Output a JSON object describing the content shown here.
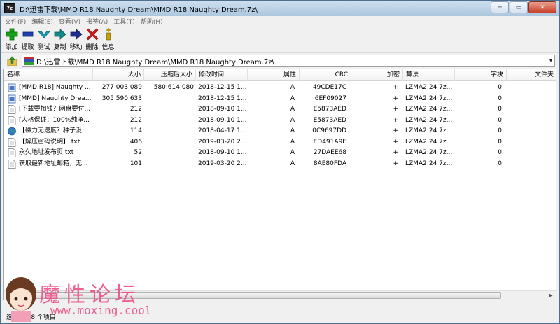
{
  "window": {
    "app_icon_text": "7z",
    "title": "D:\\迅雷下载\\MMD R18 Naughty Dream\\MMD R18 Naughty Dream.7z\\",
    "btn_min": "─",
    "btn_max": "▭",
    "btn_close": "✕"
  },
  "menu": {
    "items": [
      "文件(F)",
      "编辑(E)",
      "查看(V)",
      "书签(A)",
      "工具(T)",
      "帮助(H)"
    ]
  },
  "toolbar": {
    "add": "添加",
    "extract": "提取",
    "test": "测试",
    "copy": "复制",
    "move": "移动",
    "delete": "删除",
    "info": "信息"
  },
  "address": {
    "path": "D:\\迅雷下载\\MMD R18 Naughty Dream\\MMD R18 Naughty Dream.7z\\",
    "dropdown": "▾"
  },
  "columns": {
    "name": "名称",
    "size": "大小",
    "packed": "压缩后大小",
    "modified": "修改时间",
    "attr": "属性",
    "crc": "CRC",
    "encrypted": "加密",
    "method": "算法",
    "block": "字块",
    "folders": "文件夹"
  },
  "rows": [
    {
      "icon": "video-file-icon",
      "name": "[MMD R18] Naughty ...",
      "size": "277 003 089",
      "packed": "580 614 080",
      "modified": "2018-12-15 1...",
      "attr": "A",
      "crc": "49CDE17C",
      "encrypted": "+",
      "method": "LZMA2:24 7z...",
      "block": "0"
    },
    {
      "icon": "video-file-icon",
      "name": "[MMD] Naughty Drea...",
      "size": "305 590 633",
      "packed": "",
      "modified": "2018-12-15 1...",
      "attr": "A",
      "crc": "6EF09027",
      "encrypted": "+",
      "method": "LZMA2:24 7z...",
      "block": "0"
    },
    {
      "icon": "text-file-icon",
      "name": "[下载要掏钱？网盘要付...",
      "size": "212",
      "packed": "",
      "modified": "2018-09-10 1...",
      "attr": "A",
      "crc": "E5873AED",
      "encrypted": "+",
      "method": "LZMA2:24 7z...",
      "block": "0"
    },
    {
      "icon": "text-file-icon",
      "name": "[人格保证：100%纯净...",
      "size": "212",
      "packed": "",
      "modified": "2018-09-10 1...",
      "attr": "A",
      "crc": "E5873AED",
      "encrypted": "+",
      "method": "LZMA2:24 7z...",
      "block": "0"
    },
    {
      "icon": "globe-file-icon",
      "name": "【磁力无速度？种子没...",
      "size": "114",
      "packed": "",
      "modified": "2018-04-17 1...",
      "attr": "A",
      "crc": "0C9697DD",
      "encrypted": "+",
      "method": "LZMA2:24 7z...",
      "block": "0"
    },
    {
      "icon": "text-file-icon",
      "name": "【解压密码说明】.txt",
      "size": "406",
      "packed": "",
      "modified": "2019-03-20 2...",
      "attr": "A",
      "crc": "ED491A9E",
      "encrypted": "+",
      "method": "LZMA2:24 7z...",
      "block": "0"
    },
    {
      "icon": "text-file-icon",
      "name": "永久地址发布页.txt",
      "size": "52",
      "packed": "",
      "modified": "2018-09-10 1...",
      "attr": "A",
      "crc": "27DAEE68",
      "encrypted": "+",
      "method": "LZMA2:24 7z...",
      "block": "0"
    },
    {
      "icon": "text-file-icon",
      "name": "获取最新地址邮箱，无...",
      "size": "101",
      "packed": "",
      "modified": "2019-03-20 2...",
      "attr": "A",
      "crc": "8AE80FDA",
      "encrypted": "+",
      "method": "LZMA2:24 7z...",
      "block": "0"
    }
  ],
  "scrollbar": {
    "left_arrow": "◀",
    "right_arrow": "▶"
  },
  "status": {
    "text": "选定 0 / 8 个项目"
  },
  "watermark": {
    "title": "魔性论坛",
    "url": "www.moxing.cool"
  },
  "colors": {
    "add": "#17a317",
    "extract": "#1f3fb0",
    "test": "#1aa0b8",
    "copy": "#138a8a",
    "move": "#1f2f90",
    "delete": "#d01818",
    "info": "#c8a000",
    "watermark": "#ee4f84"
  }
}
